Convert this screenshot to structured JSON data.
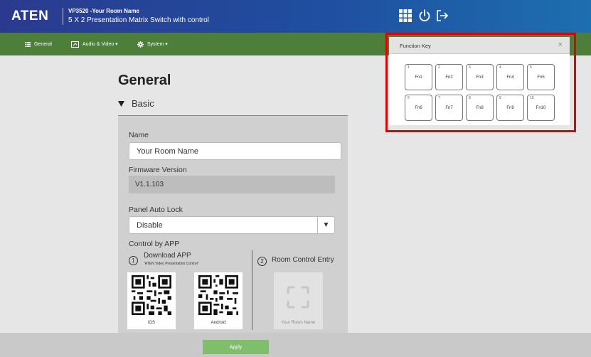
{
  "header": {
    "logo": "ATEN",
    "device_model": "VP3520 -Your Room Name",
    "device_desc": "5 X 2 Presentation Matrix Switch with control",
    "icons": [
      "grid-icon",
      "power-icon",
      "logout-icon"
    ]
  },
  "nav": {
    "general": "General",
    "audio_video": "Audio & Video ▾",
    "system": "System ▾"
  },
  "page": {
    "title": "General",
    "section": "Basic",
    "name_label": "Name",
    "name_value": "Your Room Name",
    "firmware_label": "Firmware Version",
    "firmware_value": "V1.1.103",
    "autolock_label": "Panel Auto Lock",
    "autolock_value": "Disable",
    "control_label": "Control by APP",
    "step1_num": "1",
    "step1_label": "Download APP",
    "step1_sub": "\"ATEN Video Presentation Control\"",
    "step2_num": "2",
    "step2_label": "Room Control Entry",
    "qr_ios": "iOS",
    "qr_android": "Android",
    "room_card_label": "Your Room Name"
  },
  "footer": {
    "apply": "Apply"
  },
  "function_key": {
    "title": "Function Key",
    "close": "×",
    "keys": [
      {
        "num": "1",
        "label": "Fn1"
      },
      {
        "num": "2",
        "label": "Fn2"
      },
      {
        "num": "3",
        "label": "Fn3"
      },
      {
        "num": "4",
        "label": "Fn4"
      },
      {
        "num": "5",
        "label": "Fn5"
      },
      {
        "num": "6",
        "label": "Fn6"
      },
      {
        "num": "7",
        "label": "Fn7"
      },
      {
        "num": "8",
        "label": "Fn8"
      },
      {
        "num": "9",
        "label": "Fn9"
      },
      {
        "num": "10",
        "label": "Fn10"
      }
    ]
  },
  "colors": {
    "header": "#2b3a8f",
    "nav": "#4d7f3b",
    "apply": "#7fbf6c",
    "highlight": "#e30000"
  }
}
